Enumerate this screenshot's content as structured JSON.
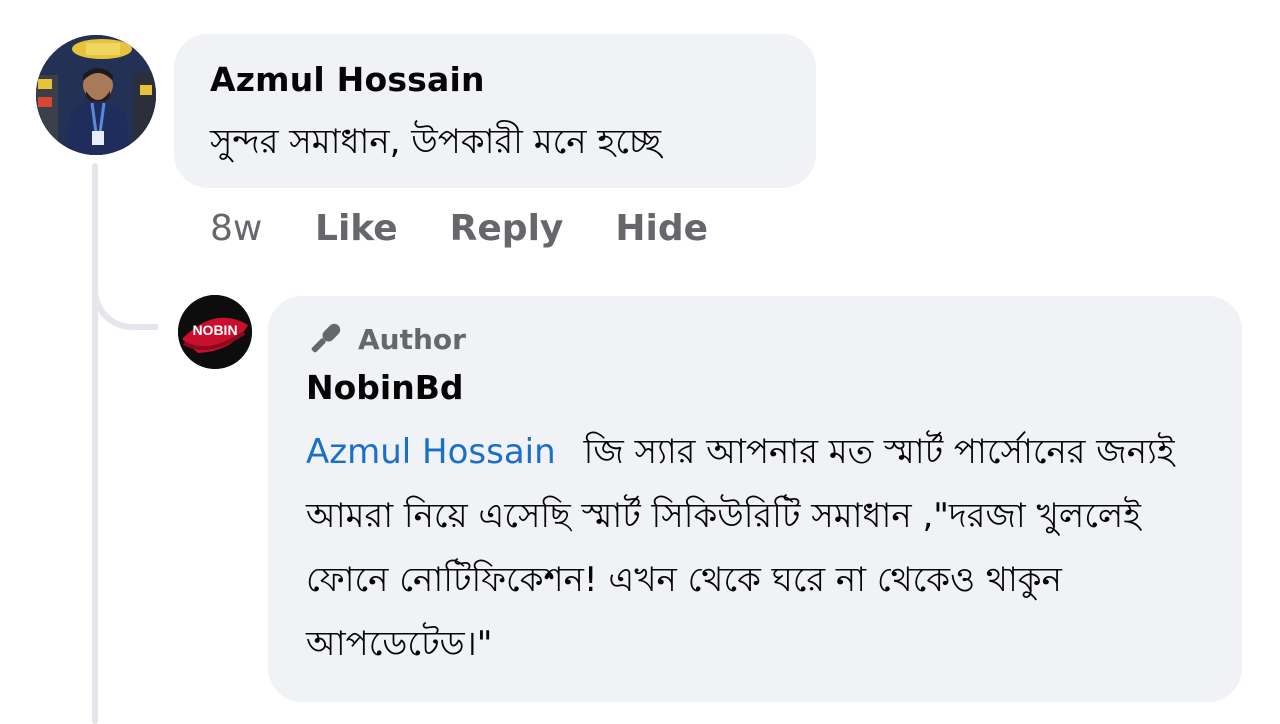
{
  "comment": {
    "author": "Azmul Hossain",
    "text": "সুন্দর সমাধান, উপকারী মনে হচ্ছে",
    "time": "8w",
    "actions": {
      "like": "Like",
      "reply": "Reply",
      "hide": "Hide"
    }
  },
  "reply": {
    "badge": "Author",
    "author": "NobinBd",
    "mention": "Azmul Hossain",
    "text": "জি স্যার আপনার মত স্মার্ট পার্সোনের জন্যই আমরা নিয়ে এসেছি স্মার্ট সিকিউরিটি সমাধান ,\"দরজা খুললেই ফোনে নোটিফিকেশন! এখন থেকে ঘরে না থেকেও থাকুন আপডেটেড।\"",
    "logo_text": "NOBIN"
  },
  "colors": {
    "bubble": "#f0f2f5",
    "secondary_text": "#65676b",
    "mention": "#1a6fc9",
    "thread_line": "#e4e6eb"
  },
  "icons": {
    "author_badge": "microphone-icon"
  }
}
